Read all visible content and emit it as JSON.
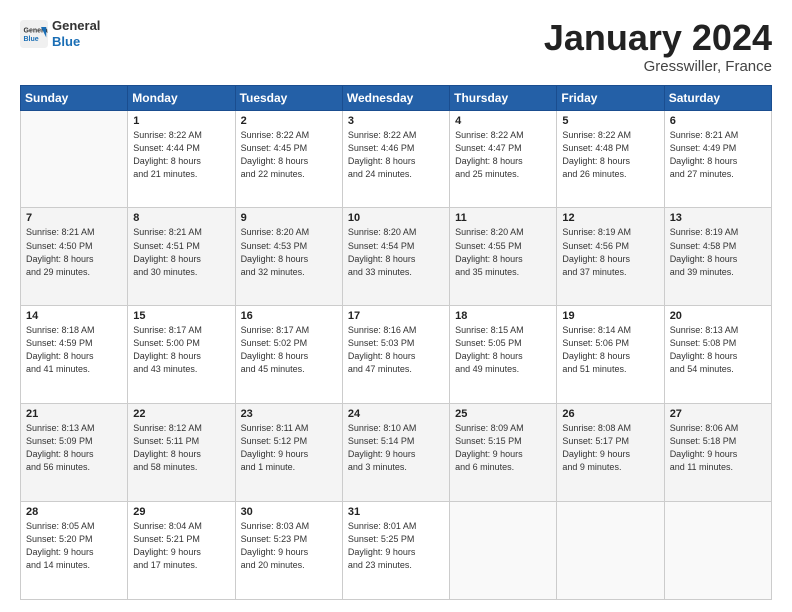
{
  "header": {
    "logo_general": "General",
    "logo_blue": "Blue",
    "title": "January 2024",
    "location": "Gresswiller, France"
  },
  "calendar": {
    "days_of_week": [
      "Sunday",
      "Monday",
      "Tuesday",
      "Wednesday",
      "Thursday",
      "Friday",
      "Saturday"
    ],
    "weeks": [
      [
        {
          "day": "",
          "info": ""
        },
        {
          "day": "1",
          "info": "Sunrise: 8:22 AM\nSunset: 4:44 PM\nDaylight: 8 hours\nand 21 minutes."
        },
        {
          "day": "2",
          "info": "Sunrise: 8:22 AM\nSunset: 4:45 PM\nDaylight: 8 hours\nand 22 minutes."
        },
        {
          "day": "3",
          "info": "Sunrise: 8:22 AM\nSunset: 4:46 PM\nDaylight: 8 hours\nand 24 minutes."
        },
        {
          "day": "4",
          "info": "Sunrise: 8:22 AM\nSunset: 4:47 PM\nDaylight: 8 hours\nand 25 minutes."
        },
        {
          "day": "5",
          "info": "Sunrise: 8:22 AM\nSunset: 4:48 PM\nDaylight: 8 hours\nand 26 minutes."
        },
        {
          "day": "6",
          "info": "Sunrise: 8:21 AM\nSunset: 4:49 PM\nDaylight: 8 hours\nand 27 minutes."
        }
      ],
      [
        {
          "day": "7",
          "info": "Sunrise: 8:21 AM\nSunset: 4:50 PM\nDaylight: 8 hours\nand 29 minutes."
        },
        {
          "day": "8",
          "info": "Sunrise: 8:21 AM\nSunset: 4:51 PM\nDaylight: 8 hours\nand 30 minutes."
        },
        {
          "day": "9",
          "info": "Sunrise: 8:20 AM\nSunset: 4:53 PM\nDaylight: 8 hours\nand 32 minutes."
        },
        {
          "day": "10",
          "info": "Sunrise: 8:20 AM\nSunset: 4:54 PM\nDaylight: 8 hours\nand 33 minutes."
        },
        {
          "day": "11",
          "info": "Sunrise: 8:20 AM\nSunset: 4:55 PM\nDaylight: 8 hours\nand 35 minutes."
        },
        {
          "day": "12",
          "info": "Sunrise: 8:19 AM\nSunset: 4:56 PM\nDaylight: 8 hours\nand 37 minutes."
        },
        {
          "day": "13",
          "info": "Sunrise: 8:19 AM\nSunset: 4:58 PM\nDaylight: 8 hours\nand 39 minutes."
        }
      ],
      [
        {
          "day": "14",
          "info": "Sunrise: 8:18 AM\nSunset: 4:59 PM\nDaylight: 8 hours\nand 41 minutes."
        },
        {
          "day": "15",
          "info": "Sunrise: 8:17 AM\nSunset: 5:00 PM\nDaylight: 8 hours\nand 43 minutes."
        },
        {
          "day": "16",
          "info": "Sunrise: 8:17 AM\nSunset: 5:02 PM\nDaylight: 8 hours\nand 45 minutes."
        },
        {
          "day": "17",
          "info": "Sunrise: 8:16 AM\nSunset: 5:03 PM\nDaylight: 8 hours\nand 47 minutes."
        },
        {
          "day": "18",
          "info": "Sunrise: 8:15 AM\nSunset: 5:05 PM\nDaylight: 8 hours\nand 49 minutes."
        },
        {
          "day": "19",
          "info": "Sunrise: 8:14 AM\nSunset: 5:06 PM\nDaylight: 8 hours\nand 51 minutes."
        },
        {
          "day": "20",
          "info": "Sunrise: 8:13 AM\nSunset: 5:08 PM\nDaylight: 8 hours\nand 54 minutes."
        }
      ],
      [
        {
          "day": "21",
          "info": "Sunrise: 8:13 AM\nSunset: 5:09 PM\nDaylight: 8 hours\nand 56 minutes."
        },
        {
          "day": "22",
          "info": "Sunrise: 8:12 AM\nSunset: 5:11 PM\nDaylight: 8 hours\nand 58 minutes."
        },
        {
          "day": "23",
          "info": "Sunrise: 8:11 AM\nSunset: 5:12 PM\nDaylight: 9 hours\nand 1 minute."
        },
        {
          "day": "24",
          "info": "Sunrise: 8:10 AM\nSunset: 5:14 PM\nDaylight: 9 hours\nand 3 minutes."
        },
        {
          "day": "25",
          "info": "Sunrise: 8:09 AM\nSunset: 5:15 PM\nDaylight: 9 hours\nand 6 minutes."
        },
        {
          "day": "26",
          "info": "Sunrise: 8:08 AM\nSunset: 5:17 PM\nDaylight: 9 hours\nand 9 minutes."
        },
        {
          "day": "27",
          "info": "Sunrise: 8:06 AM\nSunset: 5:18 PM\nDaylight: 9 hours\nand 11 minutes."
        }
      ],
      [
        {
          "day": "28",
          "info": "Sunrise: 8:05 AM\nSunset: 5:20 PM\nDaylight: 9 hours\nand 14 minutes."
        },
        {
          "day": "29",
          "info": "Sunrise: 8:04 AM\nSunset: 5:21 PM\nDaylight: 9 hours\nand 17 minutes."
        },
        {
          "day": "30",
          "info": "Sunrise: 8:03 AM\nSunset: 5:23 PM\nDaylight: 9 hours\nand 20 minutes."
        },
        {
          "day": "31",
          "info": "Sunrise: 8:01 AM\nSunset: 5:25 PM\nDaylight: 9 hours\nand 23 minutes."
        },
        {
          "day": "",
          "info": ""
        },
        {
          "day": "",
          "info": ""
        },
        {
          "day": "",
          "info": ""
        }
      ]
    ]
  }
}
